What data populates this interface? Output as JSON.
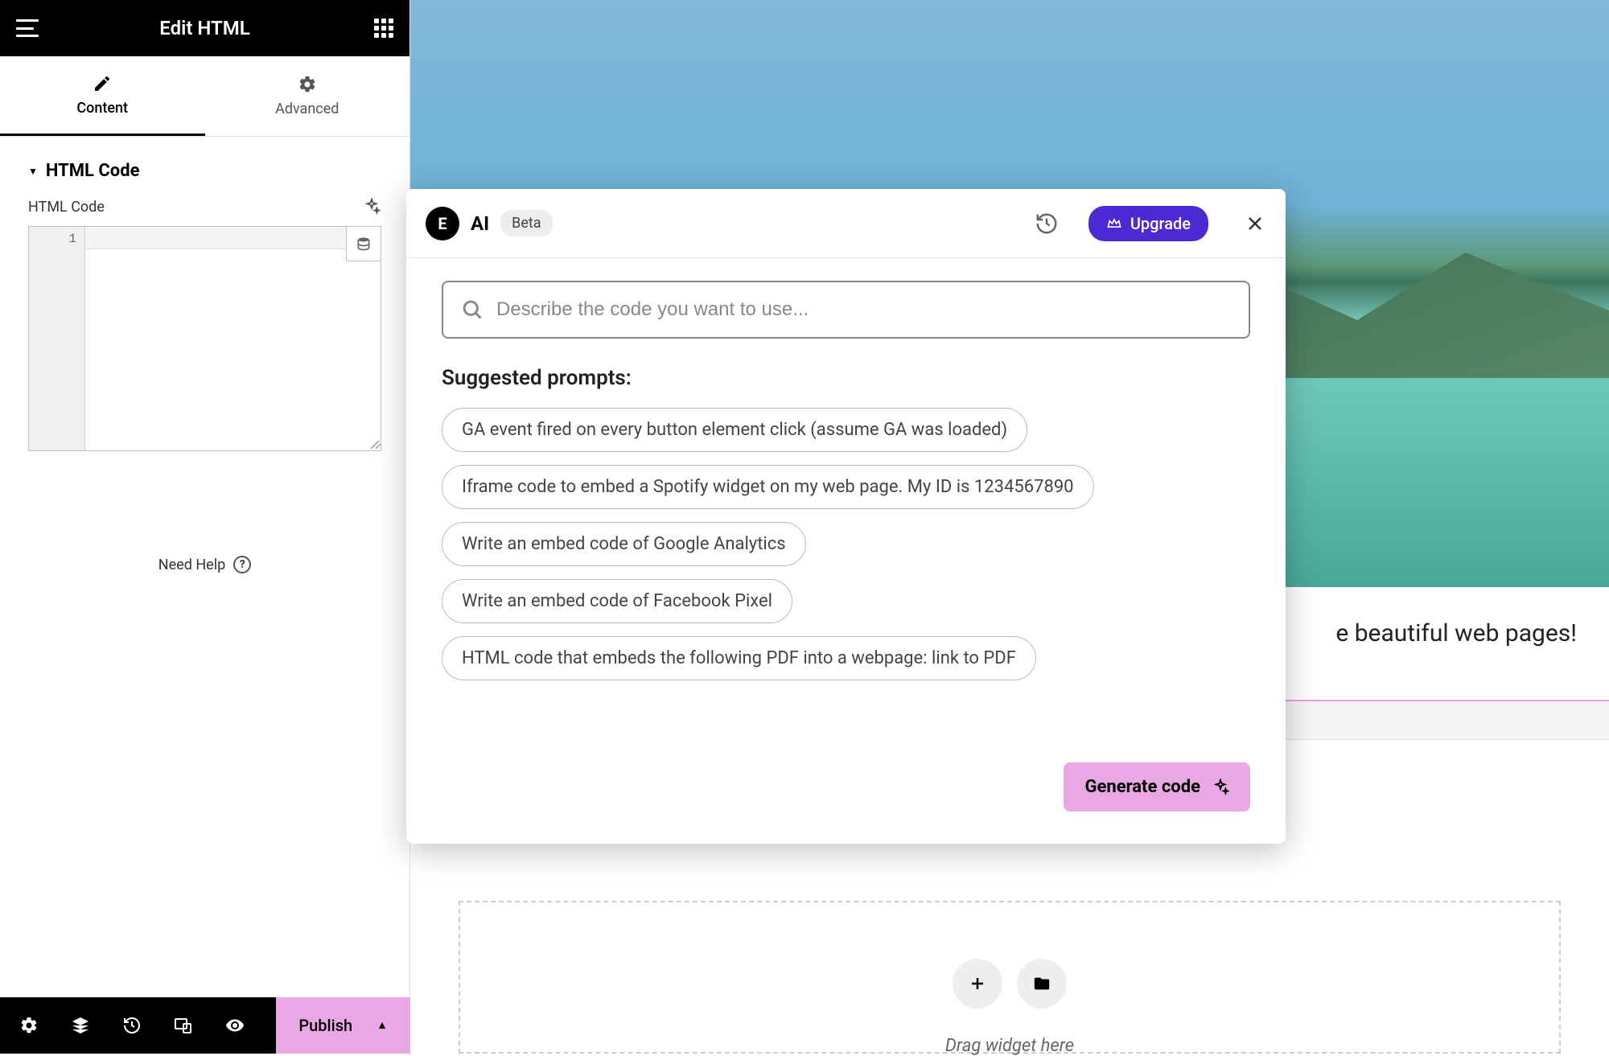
{
  "header": {
    "title": "Edit HTML"
  },
  "tabs": [
    {
      "label": "Content",
      "icon": "pencil"
    },
    {
      "label": "Advanced",
      "icon": "gear"
    }
  ],
  "section": {
    "title": "HTML Code"
  },
  "field": {
    "label": "HTML Code"
  },
  "editor": {
    "line_number": "1"
  },
  "help": {
    "label": "Need Help"
  },
  "bottom": {
    "publish_label": "Publish"
  },
  "canvas": {
    "caption_suffix": "e beautiful web pages!",
    "drop_text": "Drag widget here"
  },
  "modal": {
    "ai_label": "AI",
    "logo_glyph": "E",
    "beta_label": "Beta",
    "upgrade_label": "Upgrade",
    "prompt_placeholder": "Describe the code you want to use...",
    "suggested_title": "Suggested prompts:",
    "chips": [
      "GA event fired on every button element click (assume GA was loaded)",
      "Iframe code to embed a Spotify widget on my web page. My ID is 1234567890",
      "Write an embed code of Google Analytics",
      "Write an embed code of Facebook Pixel",
      "HTML code that embeds the following PDF into a webpage: link to PDF"
    ],
    "generate_label": "Generate code"
  }
}
